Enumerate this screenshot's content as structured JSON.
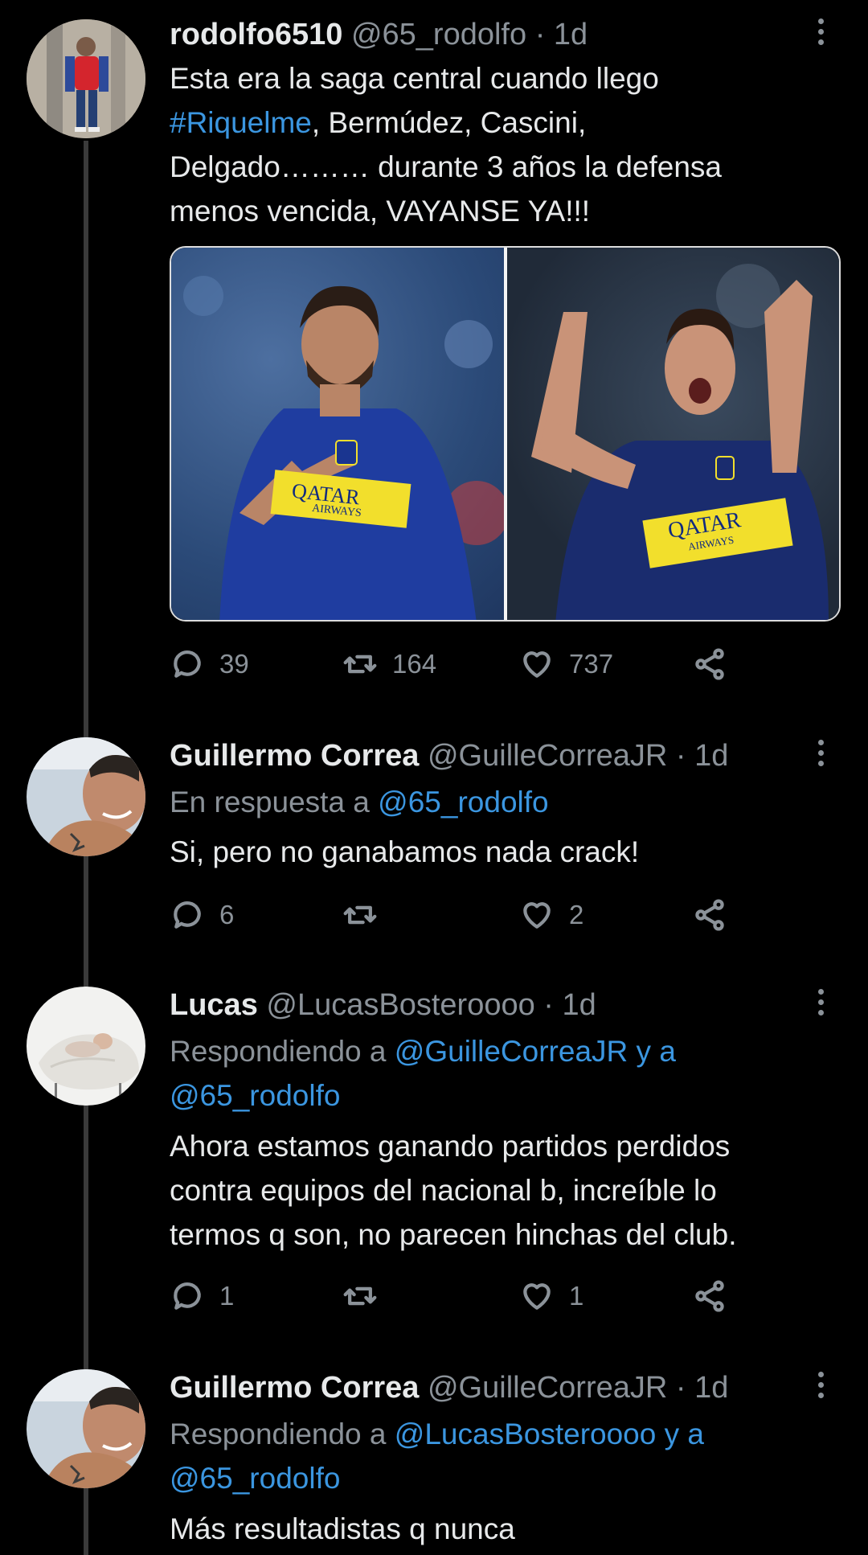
{
  "tweets": [
    {
      "name": "rodolfo6510",
      "handle": "@65_rodolfo",
      "time": "· 1d",
      "text_lines": [
        "Esta era la saga central cuando llego",
        "#Riquelme",
        ", Bermúdez, Cascini,",
        "Delgado……… durante 3 años la defensa",
        "menos vencida, VAYANSE YA!!!"
      ],
      "media": {
        "photo1": {
          "jersey_text": "QATAR",
          "jersey_sub": "AIRWAYS"
        },
        "photo2": {
          "jersey_text": "QATAR",
          "jersey_sub": "AIRWAYS"
        }
      },
      "replies": "39",
      "retweets": "164",
      "likes": "737"
    },
    {
      "name": "Guillermo Correa",
      "handle": "@GuilleCorreaJR",
      "time": "· 1d",
      "reply_prefix": "En respuesta a",
      "reply_link": "@65_rodolfo",
      "text": "Si, pero no ganabamos nada crack!",
      "replies": "6",
      "retweets": "",
      "likes": "2"
    },
    {
      "name": "Lucas",
      "handle": "@LucasBosteroooo",
      "time": "· 1d",
      "reply_prefix": "Respondiendo a",
      "reply_link1": "@GuilleCorreaJR y a",
      "reply_link2": "@65_rodolfo",
      "text_lines": [
        "Ahora estamos ganando partidos perdidos",
        "contra equipos del nacional b, increíble lo",
        "termos q son, no parecen hinchas del club."
      ],
      "replies": "1",
      "retweets": "",
      "likes": "1"
    },
    {
      "name": "Guillermo Correa",
      "handle": "@GuilleCorreaJR",
      "time": "· 1d",
      "reply_prefix": "Respondiendo a",
      "reply_link1": "@LucasBosteroooo y a",
      "reply_link2": "@65_rodolfo",
      "text": "Más resultadistas q nunca"
    }
  ],
  "icons": {
    "reply": "reply-icon",
    "retweet": "retweet-icon",
    "like": "heart-icon",
    "share": "share-icon",
    "more": "more-vertical-icon"
  },
  "colors": {
    "background": "#000000",
    "link": "#3b96e0",
    "muted": "#8b9299",
    "text": "#e7e9ea",
    "jersey_stripe": "#f2df2c"
  }
}
